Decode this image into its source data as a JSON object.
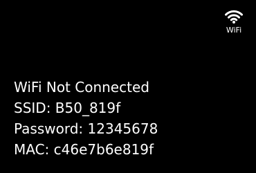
{
  "wifi_indicator": {
    "icon": "wifi-icon",
    "label": "WiFi"
  },
  "status": {
    "title": "WiFi Not Connected",
    "ssid": "SSID: B50_819f",
    "password": "Password: 12345678",
    "mac": "MAC: c46e7b6e819f"
  },
  "colors": {
    "background": "#000000",
    "text": "#ffffff"
  }
}
